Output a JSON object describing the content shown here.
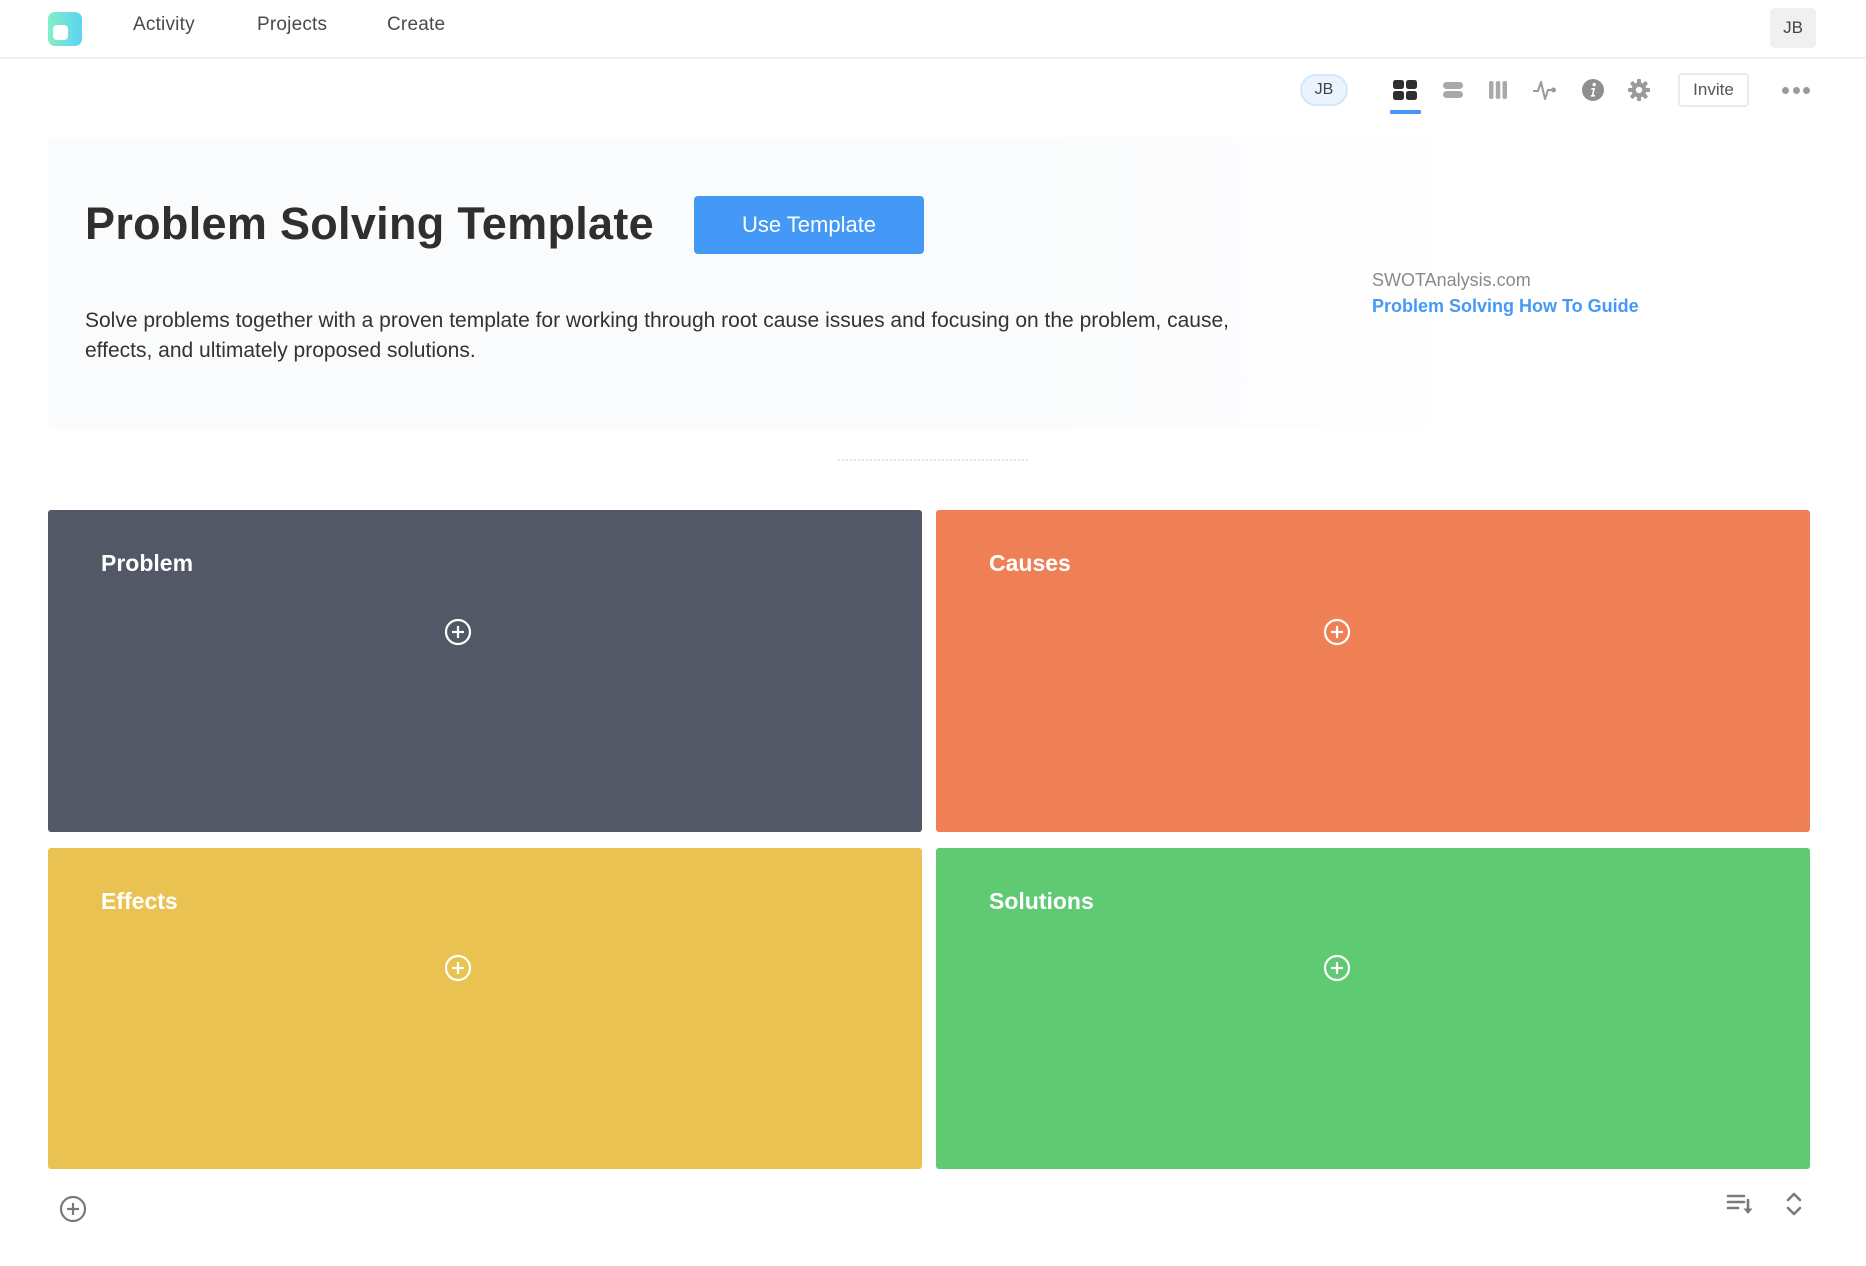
{
  "header": {
    "logo_icon": "app-logo",
    "nav": [
      {
        "label": "Activity"
      },
      {
        "label": "Projects"
      },
      {
        "label": "Create"
      }
    ],
    "user_initials": "JB"
  },
  "toolbar": {
    "member_initials": "JB",
    "views": [
      {
        "icon": "grid-view-icon",
        "active": true
      },
      {
        "icon": "rows-view-icon",
        "active": false
      },
      {
        "icon": "columns-view-icon",
        "active": false
      },
      {
        "icon": "activity-icon",
        "active": false
      },
      {
        "icon": "info-icon",
        "active": false
      },
      {
        "icon": "gear-icon",
        "active": false
      }
    ],
    "invite_label": "Invite",
    "more_icon": "more-horizontal-icon"
  },
  "hero": {
    "title": "Problem Solving Template",
    "use_template_label": "Use Template",
    "description": "Solve problems together with a proven template for working through root cause issues and focusing on the problem, cause, effects, and ultimately proposed solutions.",
    "source_label": "SWOTAnalysis.com",
    "source_link_label": "Problem Solving How To Guide"
  },
  "panels": [
    {
      "title": "Problem",
      "color": "#525866"
    },
    {
      "title": "Causes",
      "color": "#ef8056"
    },
    {
      "title": "Effects",
      "color": "#eac251"
    },
    {
      "title": "Solutions",
      "color": "#5fca72"
    }
  ],
  "colors": {
    "accent": "#4499f7",
    "link": "#4599f5"
  }
}
